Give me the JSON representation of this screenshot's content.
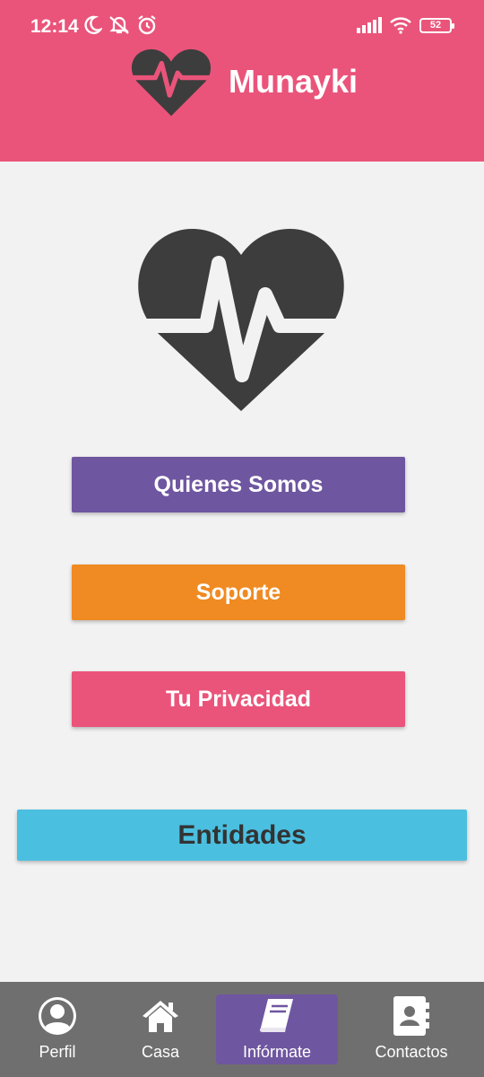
{
  "status_bar": {
    "time": "12:14",
    "battery": "52",
    "left_icons": [
      "moon-icon",
      "notifications-off-icon",
      "alarm-icon"
    ],
    "right_icons": [
      "signal-icon",
      "wifi-icon",
      "battery-icon"
    ]
  },
  "header": {
    "app_name": "Munayki",
    "logo_icon": "heart-pulse-icon",
    "background": "#ea547a"
  },
  "main": {
    "hero_icon": "heart-pulse-icon",
    "buttons": [
      {
        "label": "Quienes Somos",
        "color": "#6f56a0"
      },
      {
        "label": "Soporte",
        "color": "#f08a22"
      },
      {
        "label": "Tu Privacidad",
        "color": "#ea547a"
      }
    ],
    "entidades_button": {
      "label": "Entidades",
      "color": "#4bbfe0"
    }
  },
  "bottom_nav": {
    "background": "#706f6f",
    "active_color": "#6f56a0",
    "items": [
      {
        "label": "Perfil",
        "icon": "user-circle-icon"
      },
      {
        "label": "Casa",
        "icon": "home-icon"
      },
      {
        "label": "Infórmate",
        "icon": "book-icon",
        "active": true
      },
      {
        "label": "Contactos",
        "icon": "contacts-book-icon"
      }
    ]
  }
}
